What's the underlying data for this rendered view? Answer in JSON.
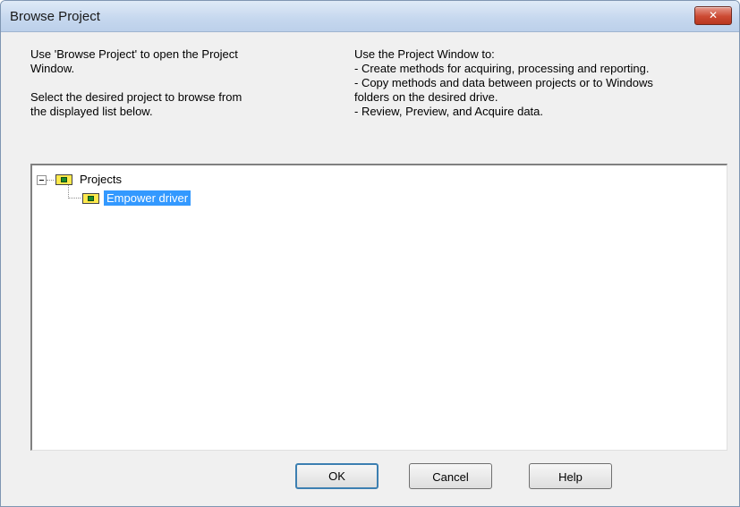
{
  "window": {
    "title": "Browse Project",
    "close_glyph": "✕"
  },
  "info": {
    "left_text": "Use 'Browse Project' to open the Project\nWindow.\n\nSelect the desired project to browse from\nthe displayed list below.",
    "right_text": "Use the Project Window to:\n- Create methods for acquiring, processing and reporting.\n- Copy methods and data between projects or to Windows\n  folders on the desired drive.\n- Review, Preview, and Acquire data."
  },
  "tree": {
    "root": {
      "label": "Projects",
      "icon": "folder-icon",
      "expanded": true
    },
    "children": [
      {
        "label": "Empower driver",
        "icon": "folder-icon",
        "selected": true
      }
    ]
  },
  "buttons": {
    "ok": "OK",
    "cancel": "Cancel",
    "help": "Help"
  },
  "colors": {
    "selection": "#3399ff",
    "close_button": "#cc4a33",
    "folder": "#ffe94d"
  }
}
